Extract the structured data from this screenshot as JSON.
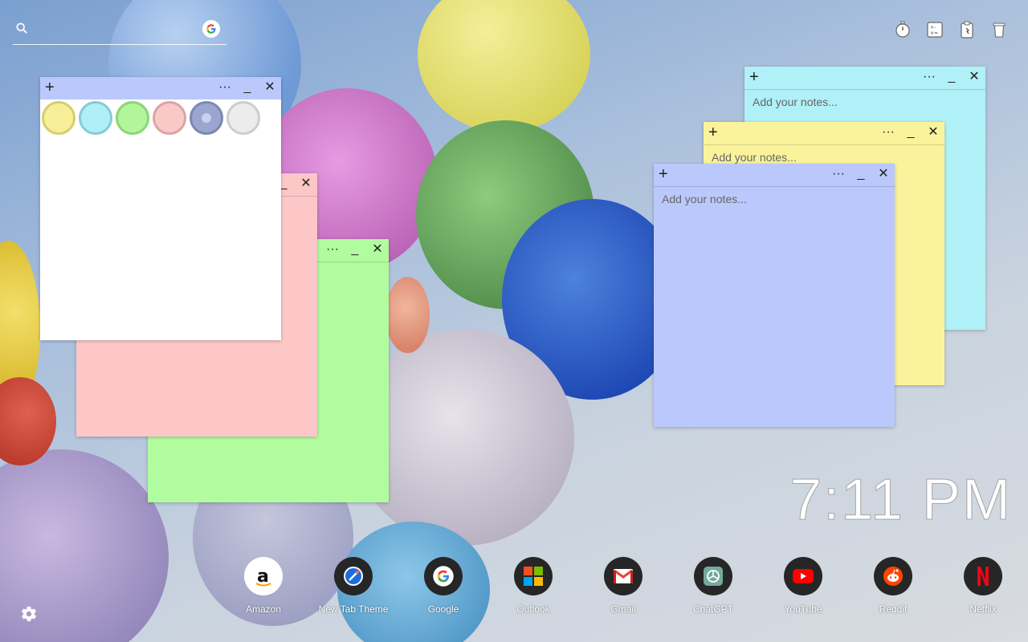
{
  "search": {
    "placeholder": ""
  },
  "top_tools": [
    {
      "icon": "stopwatch-icon"
    },
    {
      "icon": "calculator-icon"
    },
    {
      "icon": "clipboard-icon"
    },
    {
      "icon": "trash-icon"
    }
  ],
  "note_controls": {
    "add": "+",
    "more": "···",
    "minimize": "_",
    "close": "✕"
  },
  "color_note": {
    "swatches": [
      "#f7ee9a",
      "#b0eff7",
      "#b3f59b",
      "#fbc8c8",
      "#9aa6cf",
      "#ececec"
    ]
  },
  "notes": [
    {
      "id": "cyan",
      "color": "#b0f0f7",
      "placeholder": "Add your notes..."
    },
    {
      "id": "yellow",
      "color": "#faf39c",
      "placeholder": "Add your notes..."
    },
    {
      "id": "blue",
      "color": "#bac8fb",
      "placeholder": "Add your notes..."
    },
    {
      "id": "pink",
      "color": "#fdc7c7"
    },
    {
      "id": "green",
      "color": "#b1fc9e"
    }
  ],
  "clock": {
    "time": "7:11 PM"
  },
  "dock": [
    {
      "label": "Amazon",
      "icon": "amazon-icon"
    },
    {
      "label": "New Tab Theme",
      "icon": "new-tab-theme-icon"
    },
    {
      "label": "Google",
      "icon": "google-icon"
    },
    {
      "label": "Outlook",
      "icon": "outlook-icon"
    },
    {
      "label": "Gmail",
      "icon": "gmail-icon"
    },
    {
      "label": "ChatGPT",
      "icon": "chatgpt-icon"
    },
    {
      "label": "YouTube",
      "icon": "youtube-icon"
    },
    {
      "label": "Reddit",
      "icon": "reddit-icon"
    },
    {
      "label": "Netflix",
      "icon": "netflix-icon"
    }
  ]
}
